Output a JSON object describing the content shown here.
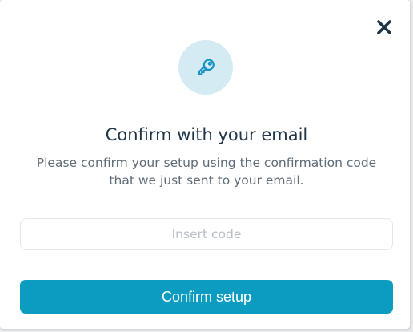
{
  "dialog": {
    "title": "Confirm with your email",
    "subtitle": "Please confirm your setup using the confirmation code that we just sent to your email.",
    "close_icon": "close-icon",
    "header_icon": "key-icon",
    "code_input": {
      "placeholder": "Insert code",
      "value": ""
    },
    "confirm_label": "Confirm setup"
  },
  "colors": {
    "accent": "#0c9cc2",
    "icon_bg": "#d4ebf4",
    "title": "#1e3447",
    "subtitle": "#5f6c78"
  }
}
